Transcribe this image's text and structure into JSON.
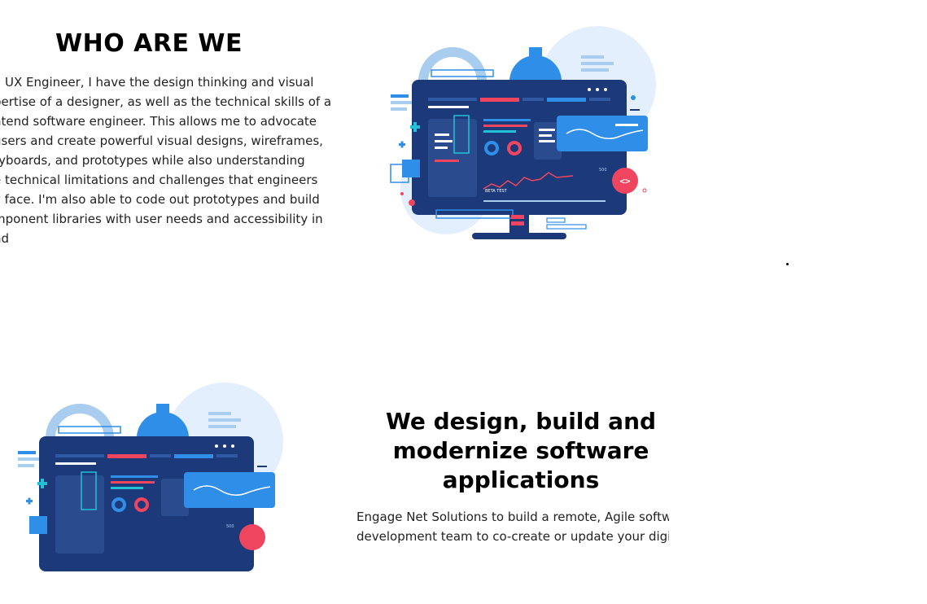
{
  "section1": {
    "title": "WHO ARE WE",
    "lines": [
      "a UX Engineer, I have the design thinking and visual",
      "pertise of a designer, as well as the technical skills of a",
      "ntend software engineer. This allows me to advocate",
      "users and create powerful visual designs, wireframes,",
      "ryboards, and prototypes while also understanding",
      "e technical limitations and challenges that engineers",
      "y face. I'm also able to code out prototypes and build",
      "mponent libraries with user needs and accessibility in",
      "nd"
    ],
    "illustration": {
      "icon": "software-dashboard-illustration",
      "label": "BETA TEST",
      "number": "500",
      "code_badge": "<>"
    }
  },
  "section2": {
    "title_lines": [
      "We design, build and",
      "modernize software",
      "applications"
    ],
    "lines": [
      "Engage Net Solutions to build a remote, Agile software",
      "development team to co-create or update your digital"
    ],
    "illustration": {
      "icon": "software-dashboard-illustration",
      "number": "500"
    }
  },
  "colors": {
    "navy": "#1c3a7a",
    "blue": "#2f8ee8",
    "light_blue": "#a9cdee",
    "pale_blue": "#e3effc",
    "red": "#f0455f",
    "teal": "#22c1d6"
  }
}
